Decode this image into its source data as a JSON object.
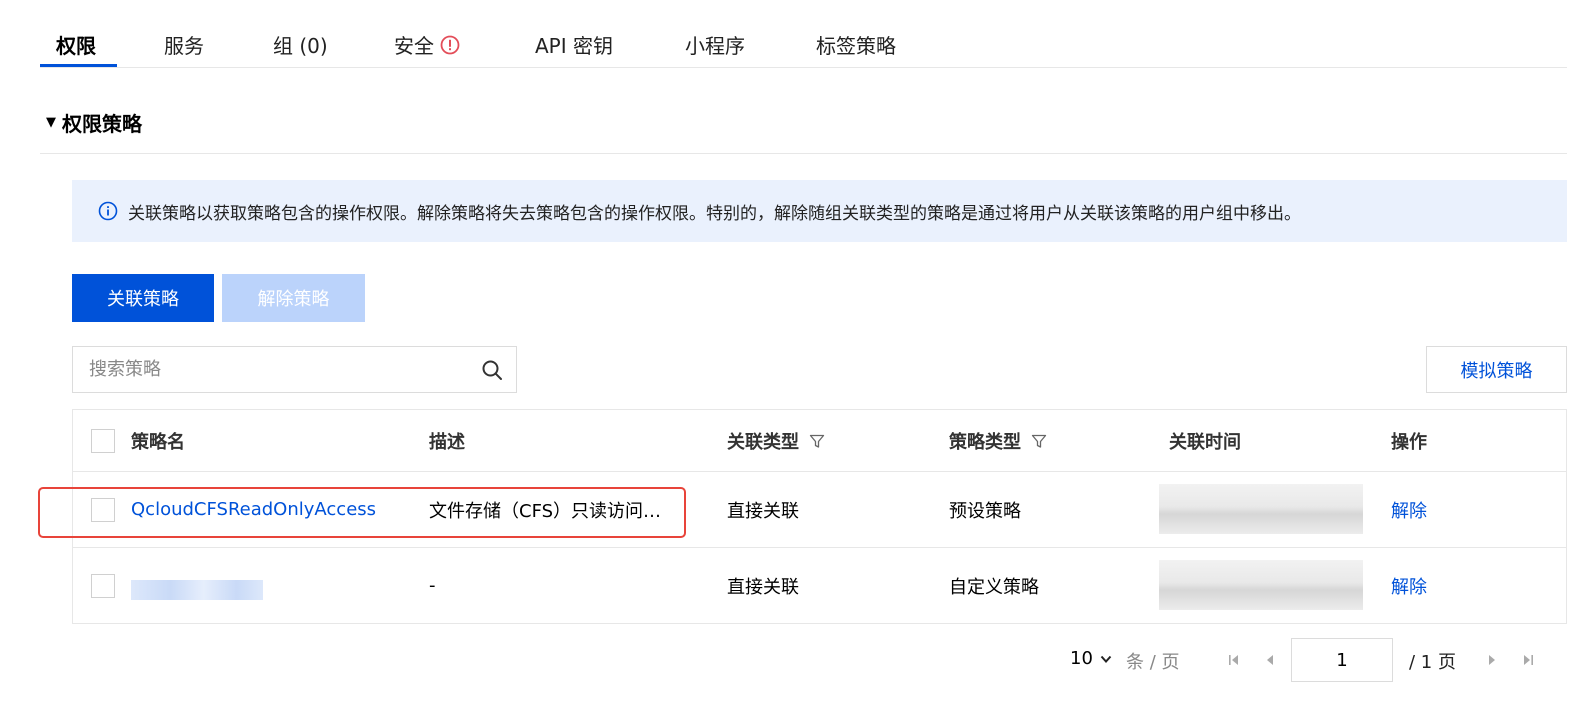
{
  "tabs": [
    {
      "label": "权限",
      "active": true
    },
    {
      "label": "服务"
    },
    {
      "label": "组 (0)"
    },
    {
      "label": "安全",
      "icon": "warning-circle-icon",
      "icon_color": "#e34d59"
    },
    {
      "label": "API 密钥"
    },
    {
      "label": "小程序"
    },
    {
      "label": "标签策略"
    }
  ],
  "section": {
    "title": "权限策略"
  },
  "banner": {
    "text": "关联策略以获取策略包含的操作权限。解除策略将失去策略包含的操作权限。特别的，解除随组关联类型的策略是通过将用户从关联该策略的用户组中移出。"
  },
  "actions": {
    "attach_label": "关联策略",
    "detach_label": "解除策略",
    "simulate_label": "模拟策略"
  },
  "search": {
    "placeholder": "搜索策略",
    "value": ""
  },
  "table": {
    "columns": [
      "策略名",
      "描述",
      "关联类型",
      "策略类型",
      "关联时间",
      "操作"
    ],
    "rows": [
      {
        "name": "QcloudCFSReadOnlyAccess",
        "description": "文件存储（CFS）只读访问…",
        "assoc_type": "直接关联",
        "policy_type": "预设策略",
        "action": "解除"
      },
      {
        "name": "",
        "description": "-",
        "assoc_type": "直接关联",
        "policy_type": "自定义策略",
        "action": "解除"
      }
    ]
  },
  "pagination": {
    "page_size": "10",
    "per_page_label": "条 / 页",
    "current_page": "1",
    "total_label": "/ 1 页"
  },
  "colors": {
    "accent": "#0052d9",
    "highlight": "#e8443a",
    "banner_bg": "#eaf1fd",
    "disabled_btn": "#bbd3fb"
  }
}
